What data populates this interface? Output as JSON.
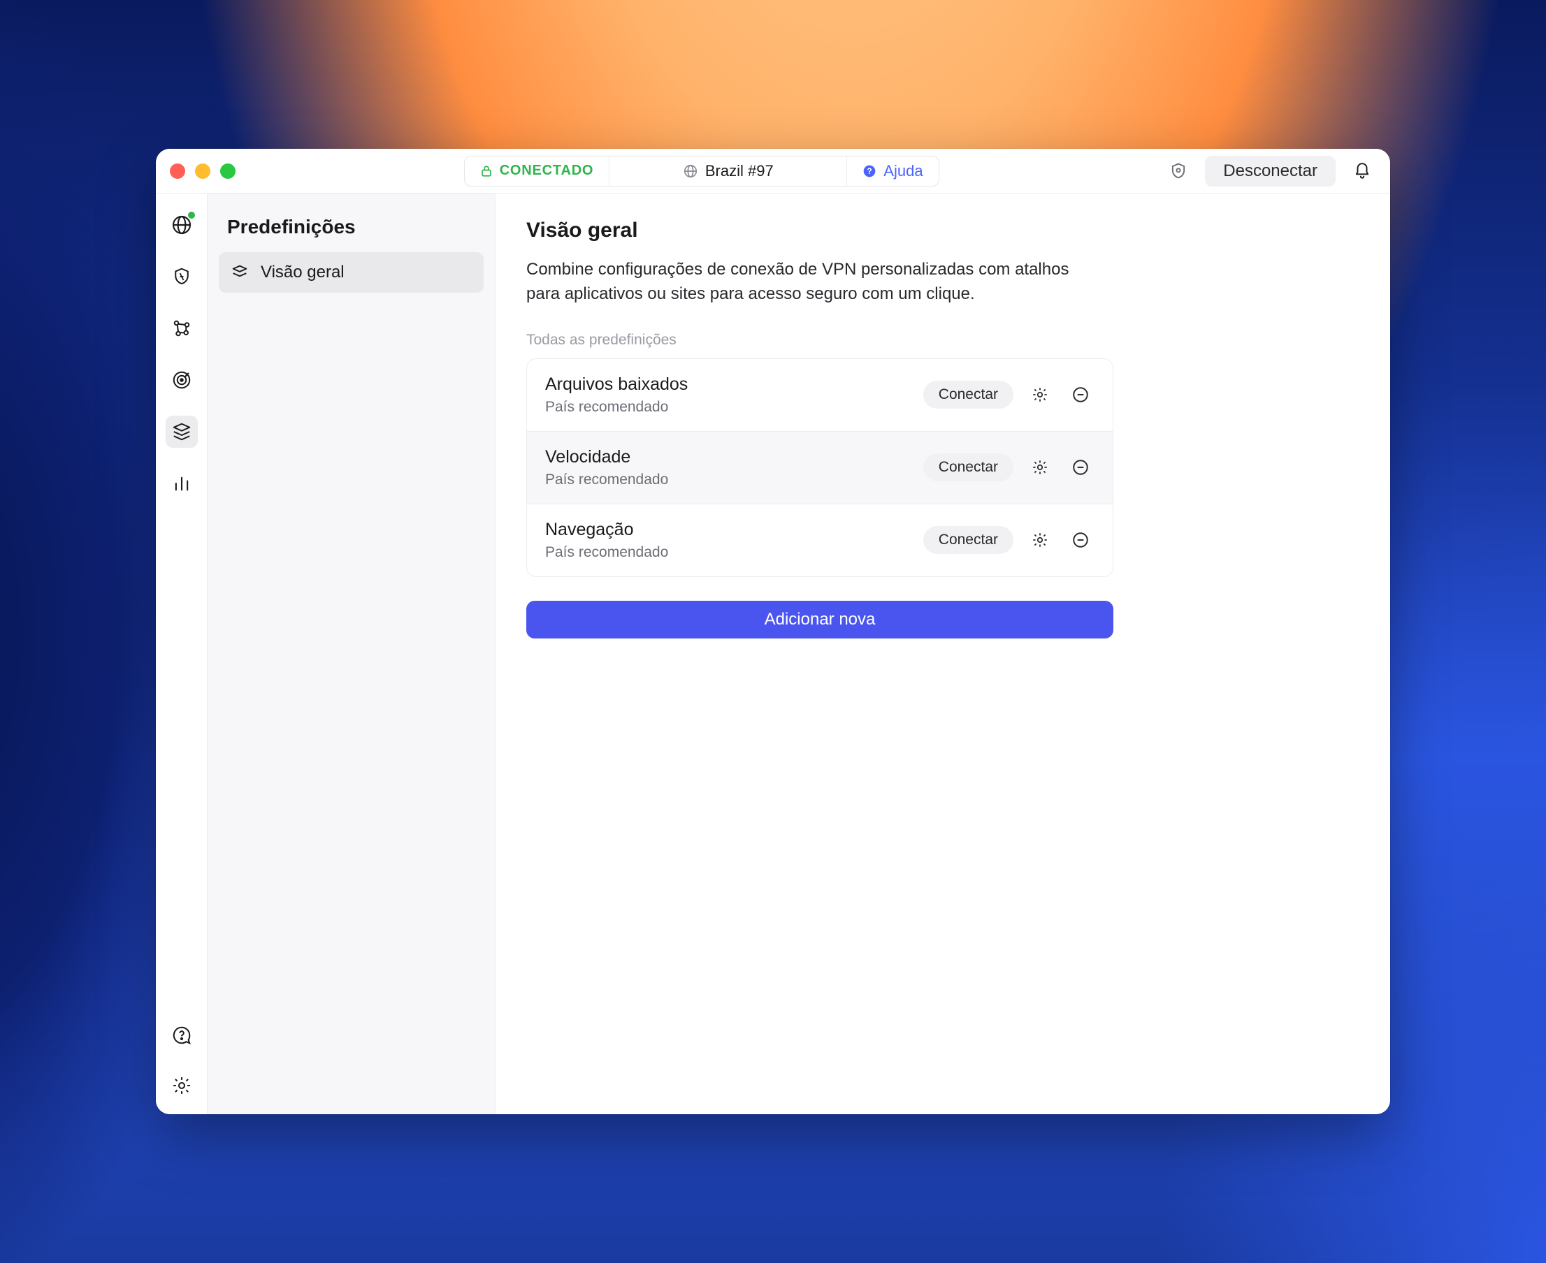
{
  "titlebar": {
    "status_label": "CONECTADO",
    "location_label": "Brazil #97",
    "help_label": "Ajuda",
    "disconnect_label": "Desconectar"
  },
  "sidebar": {
    "title": "Predefinições",
    "items": [
      {
        "label": "Visão geral"
      }
    ]
  },
  "main": {
    "title": "Visão geral",
    "description": "Combine configurações de conexão de VPN personalizadas com atalhos para aplicativos ou sites para acesso seguro com um clique.",
    "section_label": "Todas as predefinições",
    "connect_label": "Conectar",
    "add_label": "Adicionar nova",
    "presets": [
      {
        "name": "Arquivos baixados",
        "sub": "País recomendado"
      },
      {
        "name": "Velocidade",
        "sub": "País recomendado"
      },
      {
        "name": "Navegação",
        "sub": "País recomendado"
      }
    ]
  }
}
